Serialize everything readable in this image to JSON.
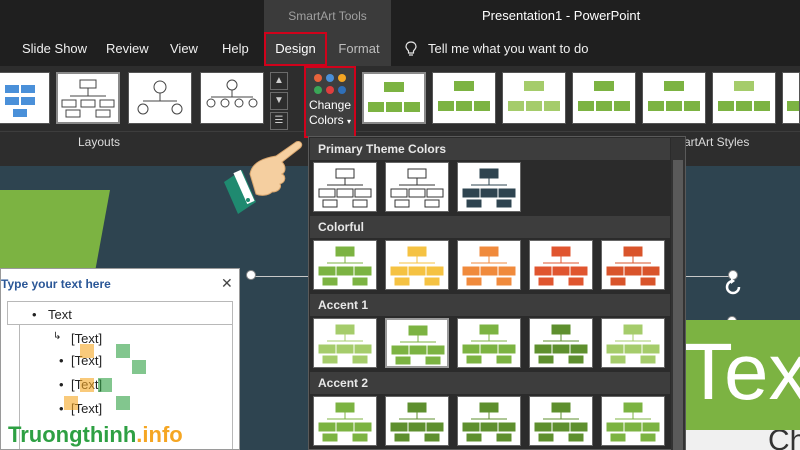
{
  "titlebar": {
    "context_tools": "SmartArt Tools",
    "window_title": "Presentation1  -  PowerPoint"
  },
  "tabs": [
    {
      "label": "Slide Show"
    },
    {
      "label": "Review"
    },
    {
      "label": "View"
    },
    {
      "label": "Help"
    },
    {
      "label": "Design",
      "active": true
    },
    {
      "label": "Format"
    }
  ],
  "tell_me": "Tell me what you want to do",
  "ribbon": {
    "layouts_label": "Layouts",
    "change_colors_line1": "Change",
    "change_colors_line2": "Colors",
    "change_colors_arrow": "▾",
    "smartart_styles_label": "SmartArt Styles",
    "dot_colors": [
      "#e8643c",
      "#4a90d9",
      "#f5a623",
      "#3aa657",
      "#e03e3e",
      "#2f6fb8"
    ]
  },
  "dropdown": {
    "sections": [
      {
        "title": "Primary Theme Colors",
        "swatches": [
          "#ffffff",
          "#ffffff",
          "#2e4450"
        ]
      },
      {
        "title": "Colorful",
        "swatches": [
          "#7cb342",
          "#f5c242",
          "#f08a3c",
          "#e0552f",
          "#d9542b"
        ]
      },
      {
        "title": "Accent 1",
        "swatches": [
          "#a5cc6b",
          "#7cb342",
          "#7cb342",
          "#5e8f2e",
          "#a5cc6b"
        ]
      },
      {
        "title": "Accent 2",
        "swatches": [
          "#7cb342",
          "#5e8f2e",
          "#5e8f2e",
          "#5e8f2e",
          "#7cb342"
        ]
      }
    ]
  },
  "text_pane": {
    "title": "Type your text here",
    "close": "✕",
    "first_item": "Text",
    "bullet": "•",
    "items": [
      "[Text]",
      "[Text]",
      "[Text]",
      "[Text]"
    ]
  },
  "slide": {
    "big_text": "Text",
    "sub_text": "Ch"
  },
  "watermark": {
    "name": "Truongthinh",
    "dot": ".",
    "tld": "info"
  },
  "colors": {
    "accent_green": "#7cb342",
    "highlight_red": "#d0021b",
    "slide_bg": "#2e4450"
  }
}
